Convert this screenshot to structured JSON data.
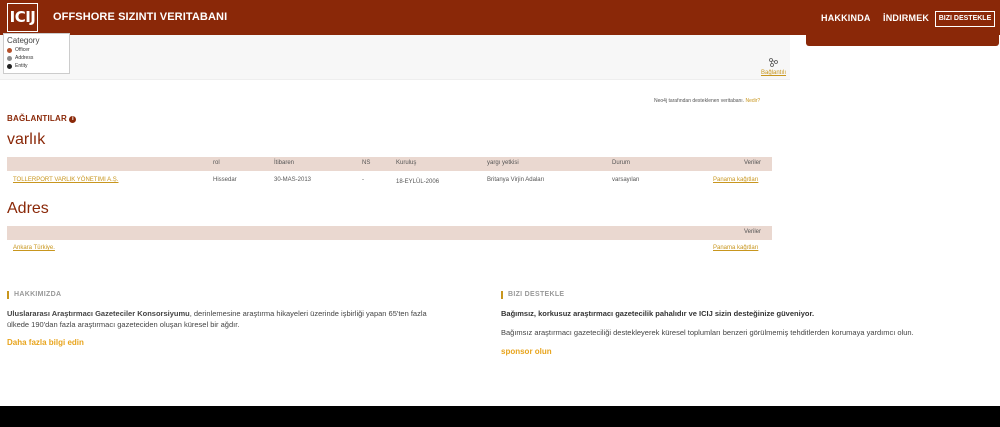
{
  "header": {
    "logo_text": "ICIJ",
    "site_title": "OFFSHORE SIZINTI VERITABANI",
    "nav": {
      "about": "HAKKINDA",
      "download": "İNDIRMEK",
      "support": "BIZI DESTEKLE"
    }
  },
  "legend": {
    "title": "Category",
    "items": [
      {
        "label": "Officer",
        "color": "#b5502a"
      },
      {
        "label": "Address",
        "color": "#8a8a8a"
      },
      {
        "label": "Entity",
        "color": "#222222"
      }
    ]
  },
  "graph": {
    "connections_link": "Bağlantılı"
  },
  "neo4j": {
    "text": "Neo4j tarafından desteklenen veritabanı",
    "link": "Nedir?"
  },
  "connections": {
    "heading": "BAĞLANTILAR",
    "entity_section": {
      "title": "varlık",
      "columns": [
        "rol",
        "İtibaren",
        "NS",
        "Kuruluş",
        "yargı yetkisi",
        "Durum",
        "Veriler"
      ],
      "rows": [
        {
          "name": "TOLLERPORT VARLIK YÖNETIMI A.Ş.",
          "role": "Hissedar",
          "from": "30-MAS-2013",
          "ns": "-",
          "incorporation": "18-EYLÜL-2006",
          "jurisdiction": "Britanya Virjin Adaları",
          "status": "varsayılan",
          "data": "Panama kağıtları"
        }
      ]
    },
    "address_section": {
      "title": "Adres",
      "columns": [
        "Veriler"
      ],
      "rows": [
        {
          "address": "Ankara Türkiye.",
          "data": "Panama kağıtları"
        }
      ]
    }
  },
  "footer": {
    "about": {
      "heading": "HAKKIMIZDA",
      "org_name": "Uluslararası Araştırmacı Gazeteciler Konsorsiyumu",
      "text_part1": ", derinlemesine araştırma hikayeleri üzerinde işbirliği yapan 65'ten fazla",
      "text_part2": "ülkede 190'dan fazla araştırmacı gazeteciden oluşan küresel bir ağdır.",
      "link": "Daha fazla bilgi edin"
    },
    "support": {
      "heading": "BIZI DESTEKLE",
      "bold_text": "Bağımsız, korkusuz araştırmacı gazetecilik pahalıdır ve ICIJ sizin desteğinize güveniyor.",
      "text": "Bağımsız araştırmacı gazeteciliği destekleyerek küresel toplumları benzeri görülmemiş tehditlerden korumaya yardımcı olun.",
      "link": "sponsor olun"
    }
  },
  "colors": {
    "brand": "#8a2808",
    "accent": "#e8a41c",
    "table_header": "#ead8d0"
  }
}
